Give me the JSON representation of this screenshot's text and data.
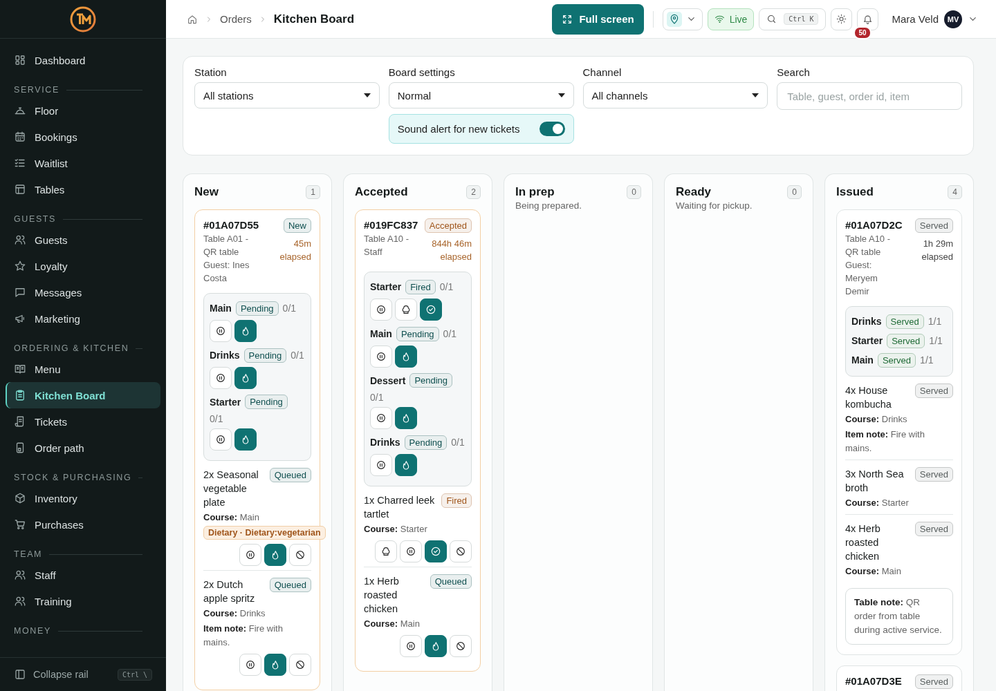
{
  "sidebar": {
    "groups": [
      {
        "items": [
          {
            "label": "Dashboard",
            "selected": false
          }
        ]
      },
      {
        "label": "SERVICE",
        "items": [
          {
            "label": "Floor",
            "selected": false
          },
          {
            "label": "Bookings",
            "selected": false
          },
          {
            "label": "Waitlist",
            "selected": false
          },
          {
            "label": "Tables",
            "selected": false
          }
        ]
      },
      {
        "label": "GUESTS",
        "items": [
          {
            "label": "Guests",
            "selected": false
          },
          {
            "label": "Loyalty",
            "selected": false
          },
          {
            "label": "Messages",
            "selected": false
          },
          {
            "label": "Marketing",
            "selected": false
          }
        ]
      },
      {
        "label": "ORDERING & KITCHEN",
        "items": [
          {
            "label": "Menu",
            "selected": false
          },
          {
            "label": "Kitchen Board",
            "selected": true
          },
          {
            "label": "Tickets",
            "selected": false
          },
          {
            "label": "Order path",
            "selected": false
          }
        ]
      },
      {
        "label": "STOCK & PURCHASING",
        "items": [
          {
            "label": "Inventory",
            "selected": false
          },
          {
            "label": "Purchases",
            "selected": false
          }
        ]
      },
      {
        "label": "TEAM",
        "items": [
          {
            "label": "Staff",
            "selected": false
          },
          {
            "label": "Training",
            "selected": false
          }
        ]
      },
      {
        "label": "MONEY"
      }
    ],
    "footer": {
      "label": "Collapse rail",
      "shortcut": "Ctrl \\"
    }
  },
  "topbar": {
    "breadcrumb": [
      "Orders",
      "Kitchen Board"
    ],
    "fullscreen": "Full screen",
    "live": "Live",
    "search_shortcut": "Ctrl K",
    "notifications": "50",
    "user": "Mara Veld",
    "initials": "MV"
  },
  "filters": [
    {
      "kind": "select",
      "label": "Station",
      "value": "All stations"
    },
    {
      "kind": "select",
      "label": "Board settings",
      "value": "Normal",
      "toggle": {
        "label": "Sound alert for new tickets",
        "on": true
      }
    },
    {
      "kind": "select",
      "label": "Channel",
      "value": "All channels"
    },
    {
      "kind": "search",
      "label": "Search",
      "placeholder": "Table, guest, order id, item"
    }
  ],
  "columns": [
    {
      "title": "New",
      "count": "1",
      "tickets": [
        {
          "id": "#01A07D55",
          "urgent": true,
          "status": {
            "label": "New",
            "color": "#0f4f4f"
          },
          "meta": [
            "Table A01 - QR table",
            "Guest: Ines Costa"
          ],
          "elapsed": "45m elapsed",
          "courses": [
            {
              "name": "Main",
              "status": {
                "label": "Pending",
                "color": "#0f4f4f"
              },
              "progress": "0/1",
              "actions": [
                {
                  "kind": "pause"
                },
                {
                  "kind": "fire"
                }
              ]
            },
            {
              "name": "Drinks",
              "status": {
                "label": "Pending",
                "color": "#0f4f4f"
              },
              "progress": "0/1",
              "actions": [
                {
                  "kind": "pause"
                },
                {
                  "kind": "fire"
                }
              ]
            },
            {
              "name": "Starter",
              "status": {
                "label": "Pending",
                "color": "#0f4f4f"
              },
              "progress": "0/1",
              "actions": [
                {
                  "kind": "pause"
                },
                {
                  "kind": "fire"
                }
              ]
            }
          ],
          "items": [
            {
              "name": "2x Seasonal vegetable plate",
              "status": {
                "label": "Queued",
                "color": "#0f4f4f"
              },
              "details": [
                "**Course:** Main"
              ],
              "tags": [
                "Dietary · Dietary:vegetarian"
              ],
              "actions": [
                {
                  "kind": "pause"
                },
                {
                  "kind": "fire"
                },
                {
                  "kind": "void"
                }
              ]
            },
            {
              "name": "2x Dutch apple spritz",
              "status": {
                "label": "Queued",
                "color": "#0f4f4f"
              },
              "details": [
                "**Course:** Drinks",
                "**Item note:** Fire with mains."
              ],
              "actions": [
                {
                  "kind": "pause"
                },
                {
                  "kind": "fire"
                },
                {
                  "kind": "void"
                }
              ]
            }
          ]
        }
      ]
    },
    {
      "title": "Accepted",
      "count": "2",
      "tickets": [
        {
          "id": "#019FC837",
          "urgent": true,
          "status": {
            "label": "Accepted",
            "color": "#a0561c"
          },
          "meta": [
            "Table A10 - Staff"
          ],
          "elapsed": "844h 46m elapsed",
          "courses": [
            {
              "name": "Starter",
              "status": {
                "label": "Fired",
                "color": "#0f4f4f"
              },
              "progress": "0/1",
              "actions": [
                {
                  "kind": "pause"
                },
                {
                  "kind": "chef"
                },
                {
                  "kind": "done"
                }
              ]
            },
            {
              "name": "Main",
              "status": {
                "label": "Pending",
                "color": "#0f4f4f"
              },
              "progress": "0/1",
              "actions": [
                {
                  "kind": "pause"
                },
                {
                  "kind": "fire"
                }
              ]
            },
            {
              "name": "Dessert",
              "status": {
                "label": "Pending",
                "color": "#0f4f4f"
              },
              "progress": "0/1",
              "actions": [
                {
                  "kind": "pause"
                },
                {
                  "kind": "fire"
                }
              ]
            },
            {
              "name": "Drinks",
              "status": {
                "label": "Pending",
                "color": "#0f4f4f"
              },
              "progress": "0/1",
              "actions": [
                {
                  "kind": "pause"
                },
                {
                  "kind": "fire"
                }
              ]
            }
          ],
          "items": [
            {
              "name": "1x Charred leek tartlet",
              "status": {
                "label": "Fired",
                "color": "#a0561c"
              },
              "details": [
                "**Course:** Starter"
              ],
              "actions": [
                {
                  "kind": "chef"
                },
                {
                  "kind": "pause"
                },
                {
                  "kind": "done"
                },
                {
                  "kind": "void"
                }
              ]
            },
            {
              "name": "1x Herb roasted chicken",
              "status": {
                "label": "Queued",
                "color": "#0f4f4f"
              },
              "details": [
                "**Course:** Main"
              ],
              "actions": [
                {
                  "kind": "pause"
                },
                {
                  "kind": "fire"
                },
                {
                  "kind": "void"
                }
              ]
            }
          ]
        }
      ]
    },
    {
      "title": "In prep",
      "count": "0",
      "subtitle": "Being prepared."
    },
    {
      "title": "Ready",
      "count": "0",
      "subtitle": "Waiting for pickup."
    },
    {
      "title": "Issued",
      "count": "4",
      "tickets": [
        {
          "id": "#01A07D2C",
          "urgent": false,
          "status": {
            "label": "Served",
            "color": "#5a6060"
          },
          "meta": [
            "Table A10 - QR table",
            "Guest: Meryem Demir"
          ],
          "elapsed": "1h 29m elapsed",
          "courses": [
            {
              "name": "Drinks",
              "status": {
                "label": "Served",
                "color": "#206b37"
              },
              "progress": "1/1"
            },
            {
              "name": "Starter",
              "status": {
                "label": "Served",
                "color": "#206b37"
              },
              "progress": "1/1"
            },
            {
              "name": "Main",
              "status": {
                "label": "Served",
                "color": "#206b37"
              },
              "progress": "1/1"
            }
          ],
          "items": [
            {
              "name": "4x House kombucha",
              "status": {
                "label": "Served",
                "color": "#5a6060"
              },
              "details": [
                "**Course:** Drinks",
                "**Item note:** Fire with mains."
              ]
            },
            {
              "name": "3x North Sea broth",
              "status": {
                "label": "Served",
                "color": "#5a6060"
              },
              "details": [
                "**Course:** Starter"
              ]
            },
            {
              "name": "4x Herb roasted chicken",
              "status": {
                "label": "Served",
                "color": "#5a6060"
              },
              "details": [
                "**Course:** Main"
              ]
            }
          ],
          "note": "**Table note:** QR order from table during active service."
        },
        {
          "id": "#01A07D3E",
          "status": {
            "label": "Served",
            "color": "#5a6060"
          }
        }
      ]
    }
  ]
}
